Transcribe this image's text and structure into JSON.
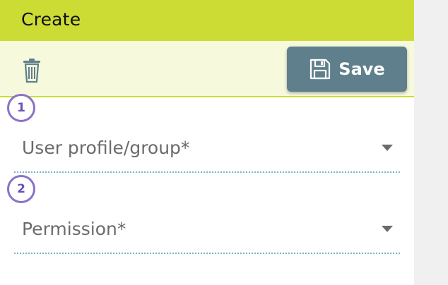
{
  "header": {
    "title": "Create"
  },
  "toolbar": {
    "delete_icon": "trash-icon",
    "save_label": "Save",
    "save_icon": "floppy-disk-icon"
  },
  "steps": [
    {
      "number": "1"
    },
    {
      "number": "2"
    }
  ],
  "form": {
    "user_profile_label": "User profile/group*",
    "permission_label": "Permission*"
  },
  "colors": {
    "header_bg": "#cddc35",
    "toolbar_bg": "#f6f9dc",
    "save_button": "#5f7f8c",
    "step_badge": "#8a72c8",
    "field_underline": "#7ab3c6"
  }
}
